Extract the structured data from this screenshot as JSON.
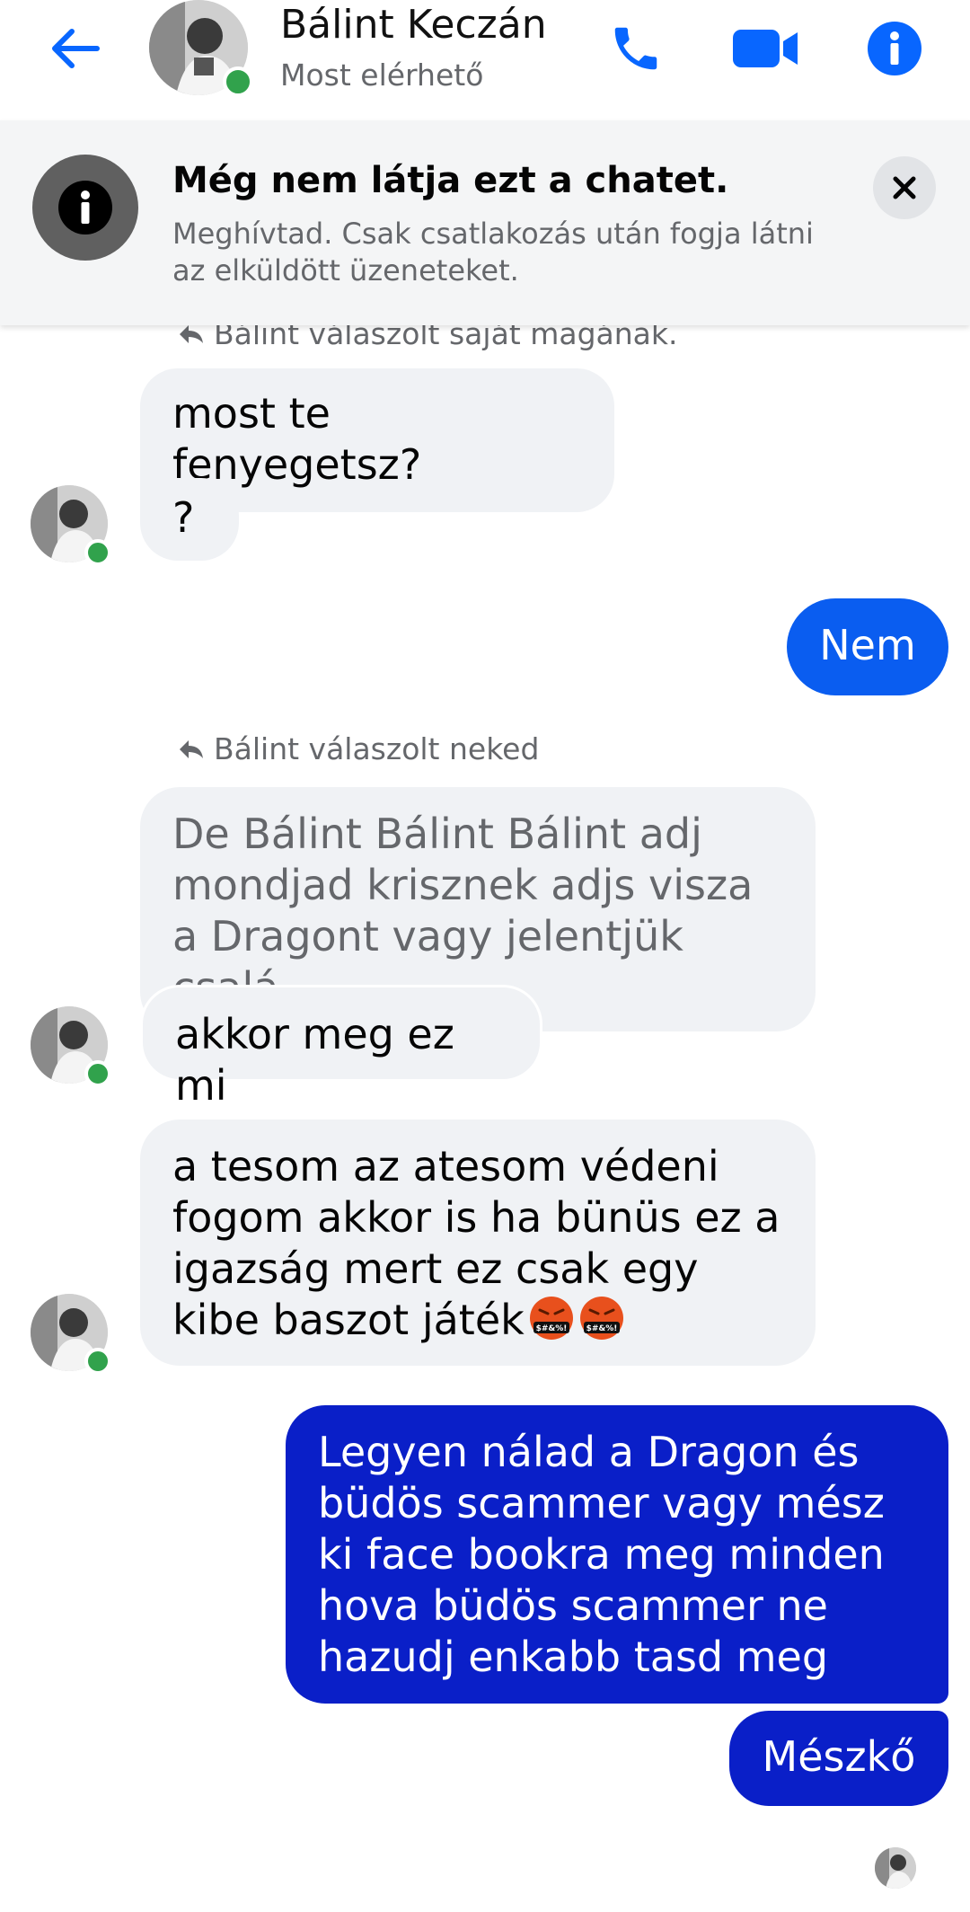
{
  "header": {
    "contact_name": "Bálint Keczán",
    "contact_status": "Most elérhető",
    "accent_color": "#0866ff",
    "icons": [
      "arrow-left-icon",
      "phone-icon",
      "video-camera-icon",
      "info-icon"
    ]
  },
  "banner": {
    "title": "Még nem látja ezt a chatet.",
    "text": "Meghívtad. Csak csatlakozás után fogja látni az elküldött üzeneteket."
  },
  "messages": {
    "reply_header_1": "Bálint válaszolt saját magának.",
    "msg_1": "most te fenyegetsz?",
    "msg_2": "?",
    "msg_3": "Nem",
    "reply_header_2": "Bálint válaszolt neked",
    "msg_4_quote": "De Bálint Bálint Bálint adj mondjad krisznek adjs  visza a Dragont vagy jelentjük csalá...",
    "msg_5": "akkor meg ez mi",
    "msg_6": "a tesom az atesom védeni fogom akkor is ha bünüs ez a igazság mert ez csak egy kibe baszot játék",
    "msg_6_emoji": "🤬🤬",
    "msg_7": "Legyen nálad a Dragon és büdös scammer vagy mész ki face bookra meg minden hova büdös scammer ne hazudj enkabb tasd meg",
    "msg_8": "Mészkő"
  },
  "colors": {
    "outgoing_bubble": "#0a1fc8",
    "outgoing_bubble_light": "#0a5df0",
    "incoming_bubble": "#f0f2f5",
    "online_dot": "#31a24c"
  }
}
